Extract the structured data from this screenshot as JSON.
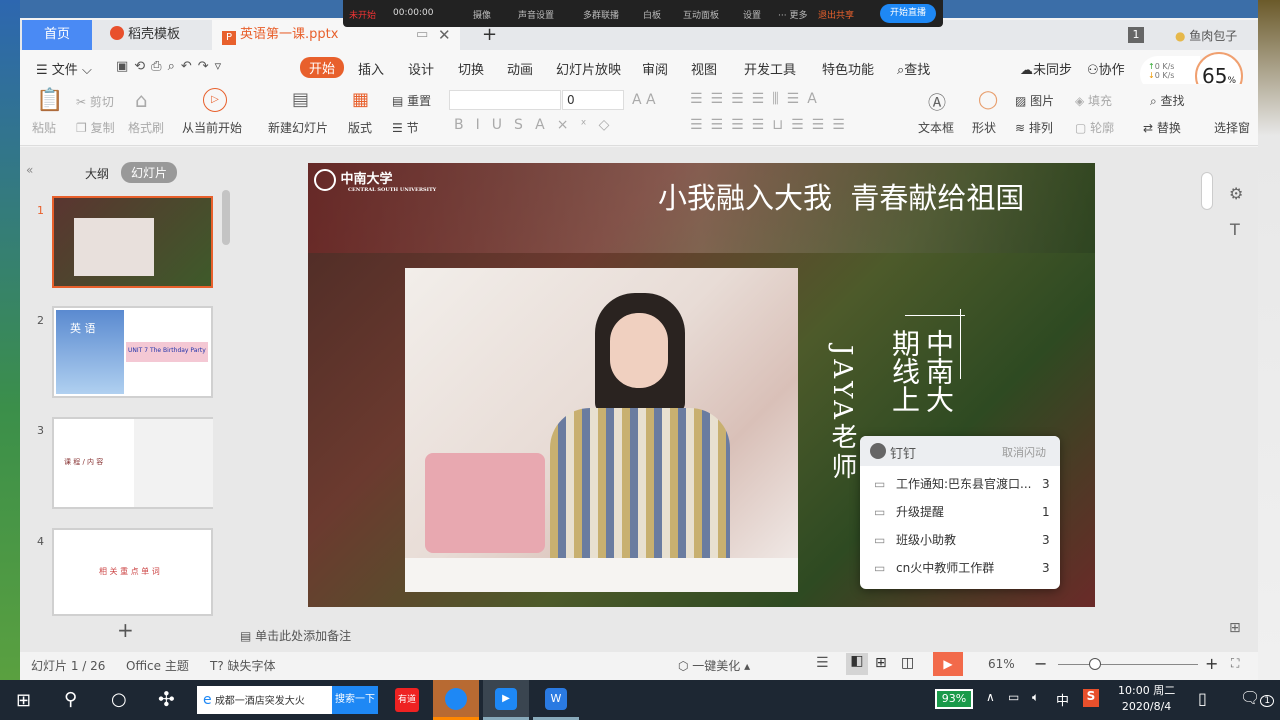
{
  "recorder": {
    "status": "未开始",
    "time": "00:00:00",
    "items": [
      "摄像",
      "声音设置",
      "多群联播",
      "白板",
      "互动面板",
      "设置",
      "··· 更多"
    ],
    "stop_share": "退出共享",
    "start_live": "开始直播"
  },
  "tabs": [
    {
      "label": "首页"
    },
    {
      "label": "稻壳模板"
    },
    {
      "label": "英语第一课.pptx"
    }
  ],
  "tabbar": {
    "new_tab": "+",
    "badge": "1",
    "user": "鱼肉包子"
  },
  "menu": {
    "file": "文件",
    "items": [
      "开始",
      "插入",
      "设计",
      "切换",
      "动画",
      "幻灯片放映",
      "审阅",
      "视图",
      "开发工具",
      "特色功能"
    ],
    "search": "查找",
    "sync": "未同步",
    "collab": "协作"
  },
  "netspeed": {
    "up": "0 K/s",
    "down": "0 K/s",
    "percent": "65",
    "unit": "%"
  },
  "ribbon": {
    "paste": "粘贴",
    "cut": "剪切",
    "copy": "复制",
    "format_painter": "格式刷",
    "play_from_current": "从当前开始",
    "new_slide": "新建幻灯片",
    "layout": "版式",
    "reset": "重置",
    "section": "节",
    "font_size": "0",
    "textbox": "文本框",
    "shape": "形状",
    "picture": "图片",
    "fill": "填充",
    "arrange": "排列",
    "outline": "轮廓",
    "find": "查找",
    "replace": "替换",
    "select": "选择窗"
  },
  "panel": {
    "outline_tab": "大纲",
    "slides_tab": "幻灯片",
    "add": "+"
  },
  "thumbnails": [
    {
      "num": "1"
    },
    {
      "num": "2",
      "title": "英 语",
      "unit": "UNIT 7",
      "subtitle": "The Birthday Party"
    },
    {
      "num": "3",
      "title": "课 程 / 内 容"
    },
    {
      "num": "4",
      "title": "相 关 重 点 单 词"
    }
  ],
  "slide": {
    "logo": "中南大学",
    "logo_sub": "CENTRAL SOUTH UNIVERSITY",
    "title": "小我融入大我  青春献给祖国",
    "vert1": "中南大",
    "vert2": "期线上",
    "vert3": "JAYA老师"
  },
  "notes_placeholder": "单击此处添加备注",
  "dingtalk": {
    "title": "钉钉",
    "cancel": "取消闪动",
    "items": [
      {
        "name": "工作通知:巴东县官渡口...",
        "count": "3"
      },
      {
        "name": "升级提醒",
        "count": "1"
      },
      {
        "name": "班级小助教",
        "count": "3"
      },
      {
        "name": "cn火中教师工作群",
        "count": "3"
      }
    ]
  },
  "status": {
    "slide_count": "幻灯片 1 / 26",
    "theme": "Office 主题",
    "missing_font": "缺失字体",
    "beautify": "一键美化",
    "zoom": "61%",
    "zoom_level": 61
  },
  "taskbar": {
    "search_text": "成都一酒店突发大火",
    "search_btn": "搜索一下",
    "youdao": "有道",
    "battery": "93%",
    "ime": "中",
    "time": "10:00 周二",
    "date": "2020/8/4",
    "notif_count": "1"
  },
  "colors": {
    "accent": "#e8602c",
    "tab_home": "#4a8af4",
    "start_live": "#1e88f5"
  }
}
